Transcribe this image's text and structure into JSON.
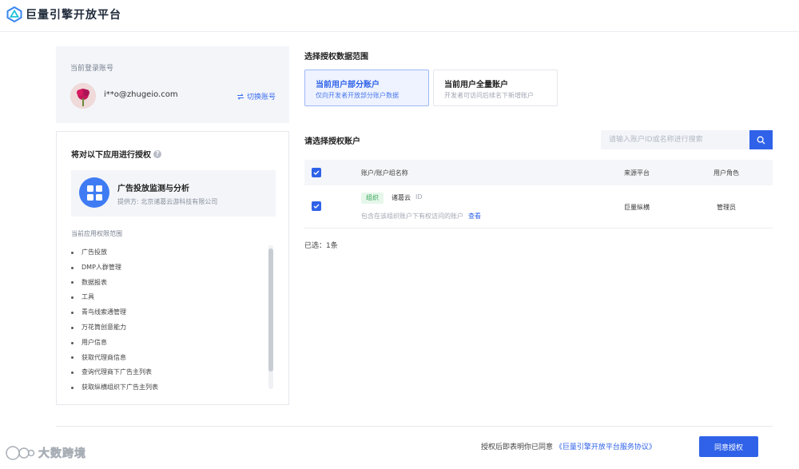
{
  "header": {
    "logo_text": "巨量引擎开放平台"
  },
  "account": {
    "label": "当前登录账号",
    "email": "i**o@zhugeio.com",
    "switch_label": "切换账号"
  },
  "app": {
    "title": "将对以下应用进行授权",
    "name": "广告投放监测与分析",
    "provider": "提供方: 北京诸葛云游科技有限公司",
    "scope_label": "当前应用权限范围",
    "scopes": [
      "广告投放",
      "DMP人群管理",
      "数据报表",
      "工具",
      "青鸟线索通管理",
      "万花筒创意能力",
      "用户信息",
      "获取代理商信息",
      "查询代理商下广告主列表",
      "获取纵横组织下广告主列表"
    ]
  },
  "scope_section": {
    "title": "选择授权数据范围",
    "options": [
      {
        "title": "当前用户部分账户",
        "desc": "仅向开发者开放部分账户数据"
      },
      {
        "title": "当前用户全量账户",
        "desc": "开发者可访问后续名下新增账户"
      }
    ]
  },
  "account_select": {
    "label": "请选择授权账户",
    "search_placeholder": "请输入账户ID或名称进行搜索",
    "columns": [
      "账户/账户组名称",
      "来源平台",
      "用户角色"
    ],
    "rows": [
      {
        "tag": "组织",
        "name": "诸葛云",
        "id_label": "ID",
        "desc": "包含在该组织账户下有权访问的账户",
        "view": "查看",
        "platform": "巨量纵横",
        "role": "管理员"
      }
    ],
    "selected_text": "已选：1条"
  },
  "footer": {
    "agree_prefix": "授权后即表明你已同意",
    "agree_link": "《巨量引擎开放平台服务协议》",
    "agree_button": "同意授权"
  },
  "watermark": {
    "text": "大数跨境"
  },
  "colors": {
    "accent": "#2f62e8",
    "tag_green": "#36a458"
  }
}
